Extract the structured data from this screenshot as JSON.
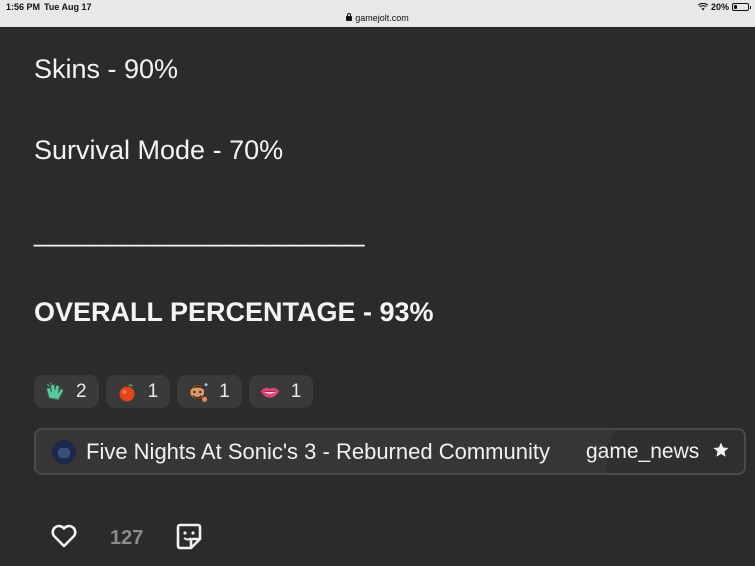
{
  "statusbar": {
    "time": "1:56 PM",
    "date": "Tue Aug 17",
    "url": "gamejolt.com",
    "battery": "20%",
    "battery_level": 0.2
  },
  "post": {
    "lines": [
      "Skins - 90%",
      "Survival Mode - 70%",
      "______________________",
      "OVERALL PERCENTAGE - 93%"
    ]
  },
  "reactions": [
    {
      "icon": "clapping-hands-icon",
      "count": "2"
    },
    {
      "icon": "apple-icon",
      "count": "1"
    },
    {
      "icon": "face-sticker-icon",
      "count": "1"
    },
    {
      "icon": "lips-icon",
      "count": "1"
    }
  ],
  "community": {
    "name": "Five Nights At Sonic's 3 - Reburned Community",
    "channel": "game_news",
    "star_icon": "star-icon"
  },
  "actions": {
    "like_icon": "heart-icon",
    "like_count": "127",
    "sticker_icon": "sticker-icon"
  },
  "colors": {
    "background": "#2b2b2b",
    "chip": "#3a3a3a",
    "text": "#f1f1f1",
    "muted": "#8b8b8b"
  }
}
